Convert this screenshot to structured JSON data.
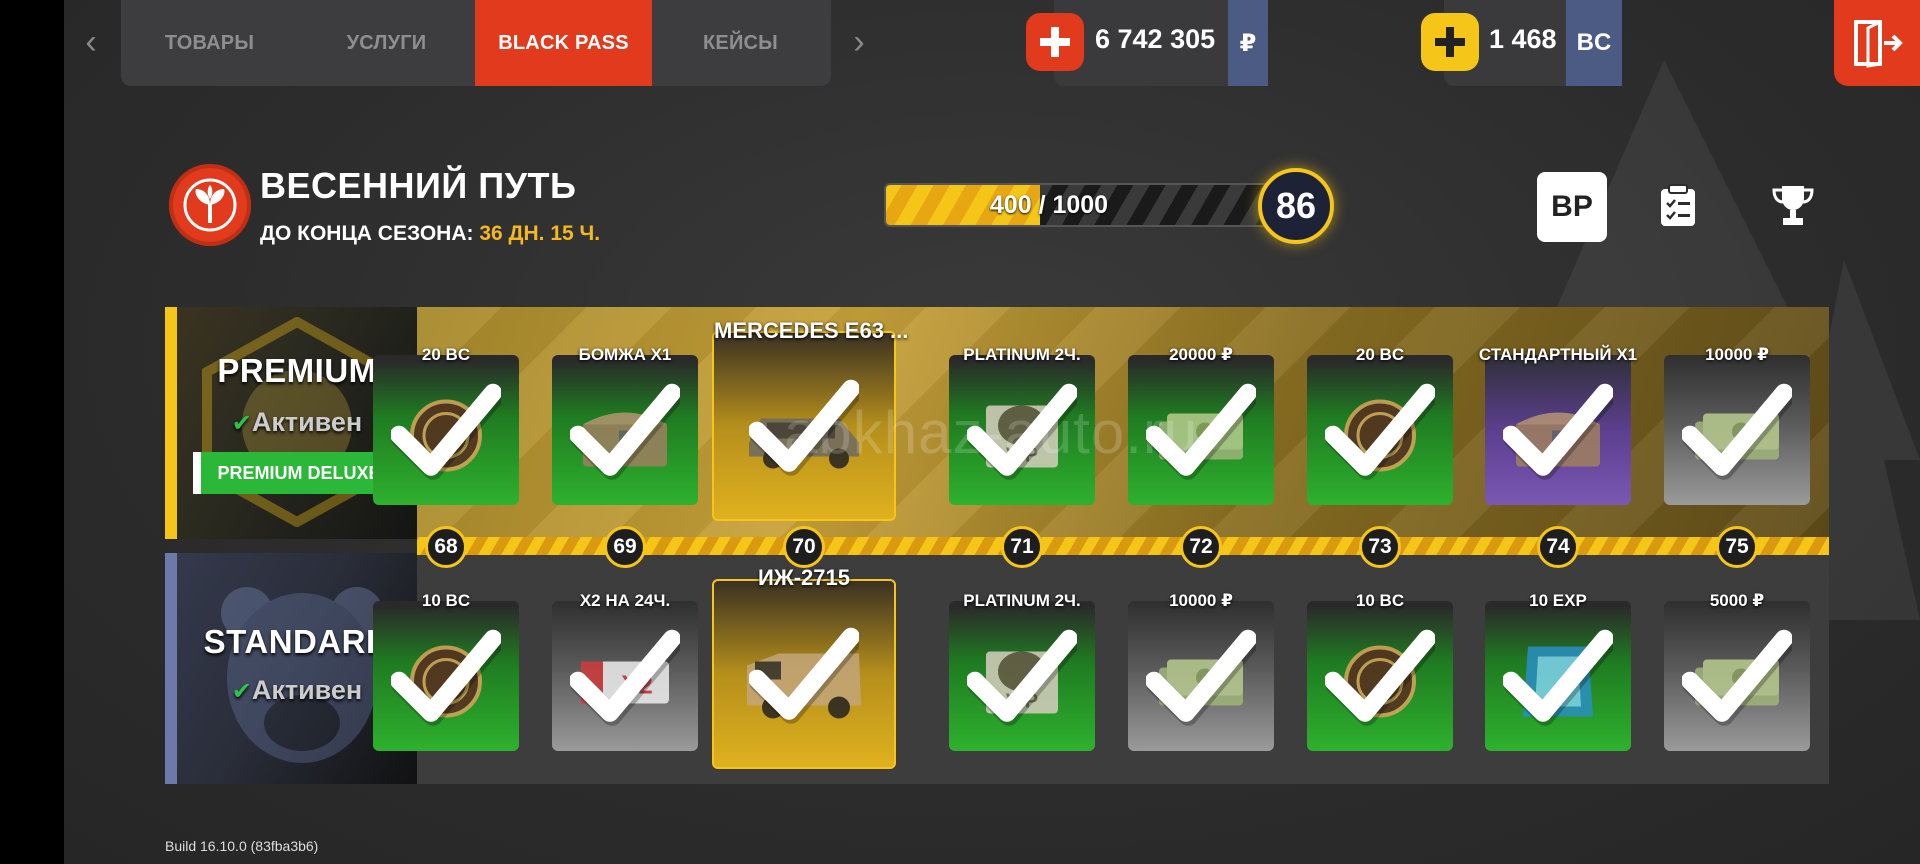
{
  "nav": {
    "tabs": [
      {
        "label": "ТОВАРЫ",
        "active": false
      },
      {
        "label": "УСЛУГИ",
        "active": false
      },
      {
        "label": "BLACK PASS",
        "active": true
      },
      {
        "label": "КЕЙСЫ",
        "active": false
      }
    ],
    "prev_icon": "chevron-left-icon",
    "next_icon": "chevron-right-icon"
  },
  "wallet": {
    "rubles": {
      "value": "6 742 305",
      "unit": "₽",
      "icon": "plus-icon"
    },
    "bc": {
      "value": "1 468",
      "unit": "BC",
      "icon": "plus-icon"
    }
  },
  "season": {
    "title": "ВЕСЕННИЙ ПУТЬ",
    "time_label": "ДО КОНЦА СЕЗОНА:",
    "time_value": "36 ДН. 15 Ч.",
    "progress_text": "400 / 1000",
    "progress_fraction": 0.4,
    "level": "86"
  },
  "actions": {
    "bp_label": "BP",
    "tasks_icon": "checklist-icon",
    "trophy_icon": "trophy-icon",
    "exit_icon": "exit-door-icon"
  },
  "premium": {
    "title": "PREMIUM",
    "status": "Активен",
    "deluxe_label": "PREMIUM DELUXE"
  },
  "standard": {
    "title": "STANDARD",
    "status": "Активен"
  },
  "levels": [
    "68",
    "69",
    "70",
    "71",
    "72",
    "73",
    "74",
    "75"
  ],
  "premium_rewards": [
    {
      "title": "20 BC",
      "style": "green",
      "item": "bc-coin"
    },
    {
      "title": "БОМЖА X1",
      "style": "green",
      "item": "chest"
    },
    {
      "title": "MERCEDES E63 ...",
      "style": "gold",
      "item": "car"
    },
    {
      "title": "PLATINUM 2Ч.",
      "style": "green",
      "item": "vip-bear"
    },
    {
      "title": "20000 ₽",
      "style": "green",
      "item": "cash"
    },
    {
      "title": "20 BC",
      "style": "green",
      "item": "bc-coin"
    },
    {
      "title": "СТАНДАРТНЫЙ X1",
      "style": "purple",
      "item": "chest"
    },
    {
      "title": "10000 ₽",
      "style": "grey",
      "item": "cash"
    }
  ],
  "standard_rewards": [
    {
      "title": "10 BC",
      "style": "green",
      "item": "bc-coin"
    },
    {
      "title": "X2 НА 24Ч.",
      "style": "grey",
      "item": "x2-ticket"
    },
    {
      "title": "ИЖ-2715",
      "style": "gold",
      "item": "van"
    },
    {
      "title": "PLATINUM 2Ч.",
      "style": "green",
      "item": "vip-bear"
    },
    {
      "title": "10000 ₽",
      "style": "grey",
      "item": "cash"
    },
    {
      "title": "10 BC",
      "style": "green",
      "item": "bc-coin"
    },
    {
      "title": "10 EXP",
      "style": "green",
      "item": "exp-card"
    },
    {
      "title": "5000 ₽",
      "style": "grey",
      "item": "cash"
    }
  ],
  "footer": {
    "build": "Build 16.10.0 (83fba3b6)"
  },
  "watermark": "abkhaz-auto.ru",
  "colors": {
    "accent_red": "#e23a1d",
    "gold": "#f5c518",
    "green": "#2eb12e",
    "bc_blue": "#4b5b83"
  }
}
